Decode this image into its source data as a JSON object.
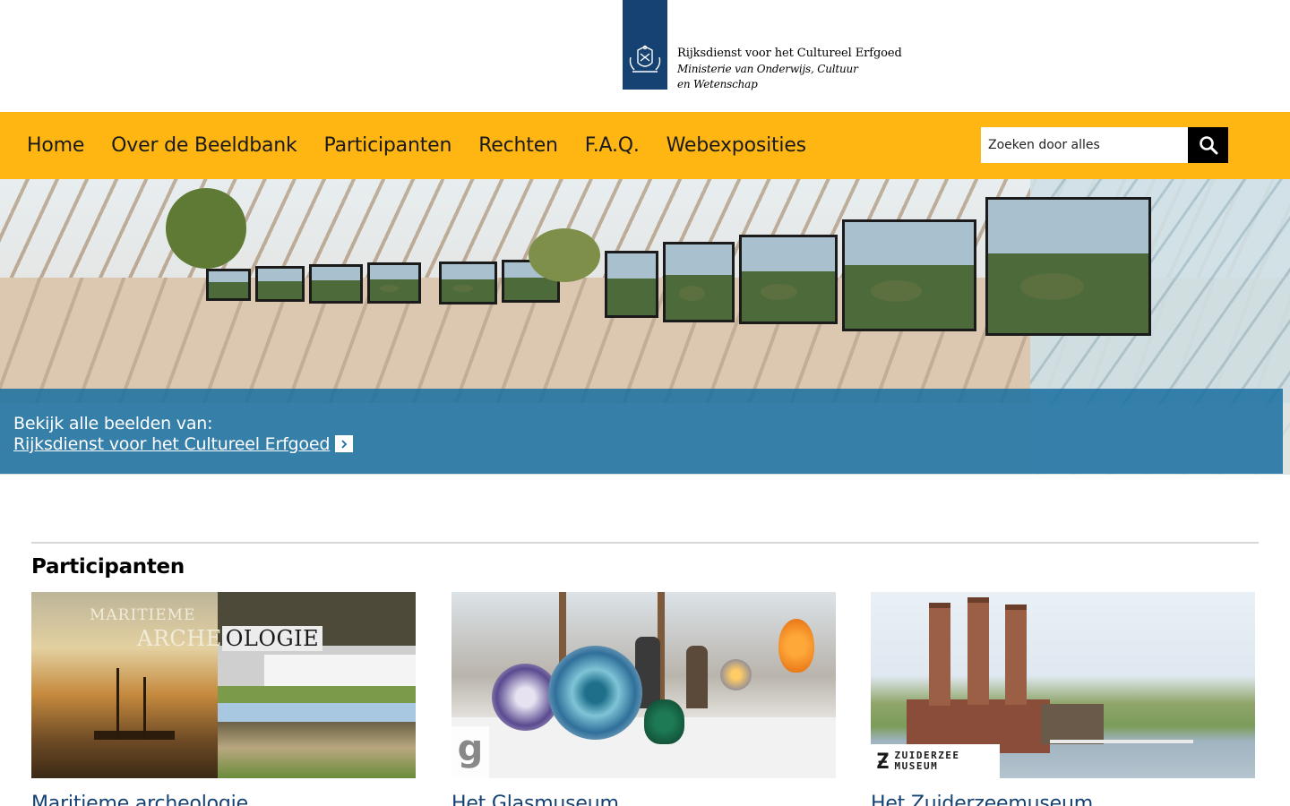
{
  "header": {
    "org_name": "Rijksdienst voor het Cultureel Erfgoed",
    "ministry": "Ministerie van Onderwijs, Cultuur en Wetenschap"
  },
  "nav": {
    "items": [
      "Home",
      "Over de Beeldbank",
      "Participanten",
      "Rechten",
      "F.A.Q.",
      "Webexposities"
    ]
  },
  "search": {
    "placeholder": "Zoeken door alles",
    "icon": "search-icon"
  },
  "hero": {
    "intro": "Bekijk alle beelden van:",
    "link": "Rijksdienst voor het Cultureel Erfgoed",
    "icon": "chevron-right-icon"
  },
  "section": {
    "title": "Participanten"
  },
  "cards": [
    {
      "caption": "Maritieme archeologie",
      "image_text_1": "MARITIEME",
      "image_text_2a": "ARCHE",
      "image_text_2b": "OLOGIE"
    },
    {
      "caption": "Het Glasmuseum",
      "image_text": "g"
    },
    {
      "caption": "Het Zuiderzeemuseum",
      "image_text": "ZUIDERZEE MUSEUM"
    }
  ],
  "colors": {
    "nav_bg": "#ffb612",
    "logo_bg": "#154273",
    "banner_bg": "#176ea0",
    "link": "#154273"
  }
}
